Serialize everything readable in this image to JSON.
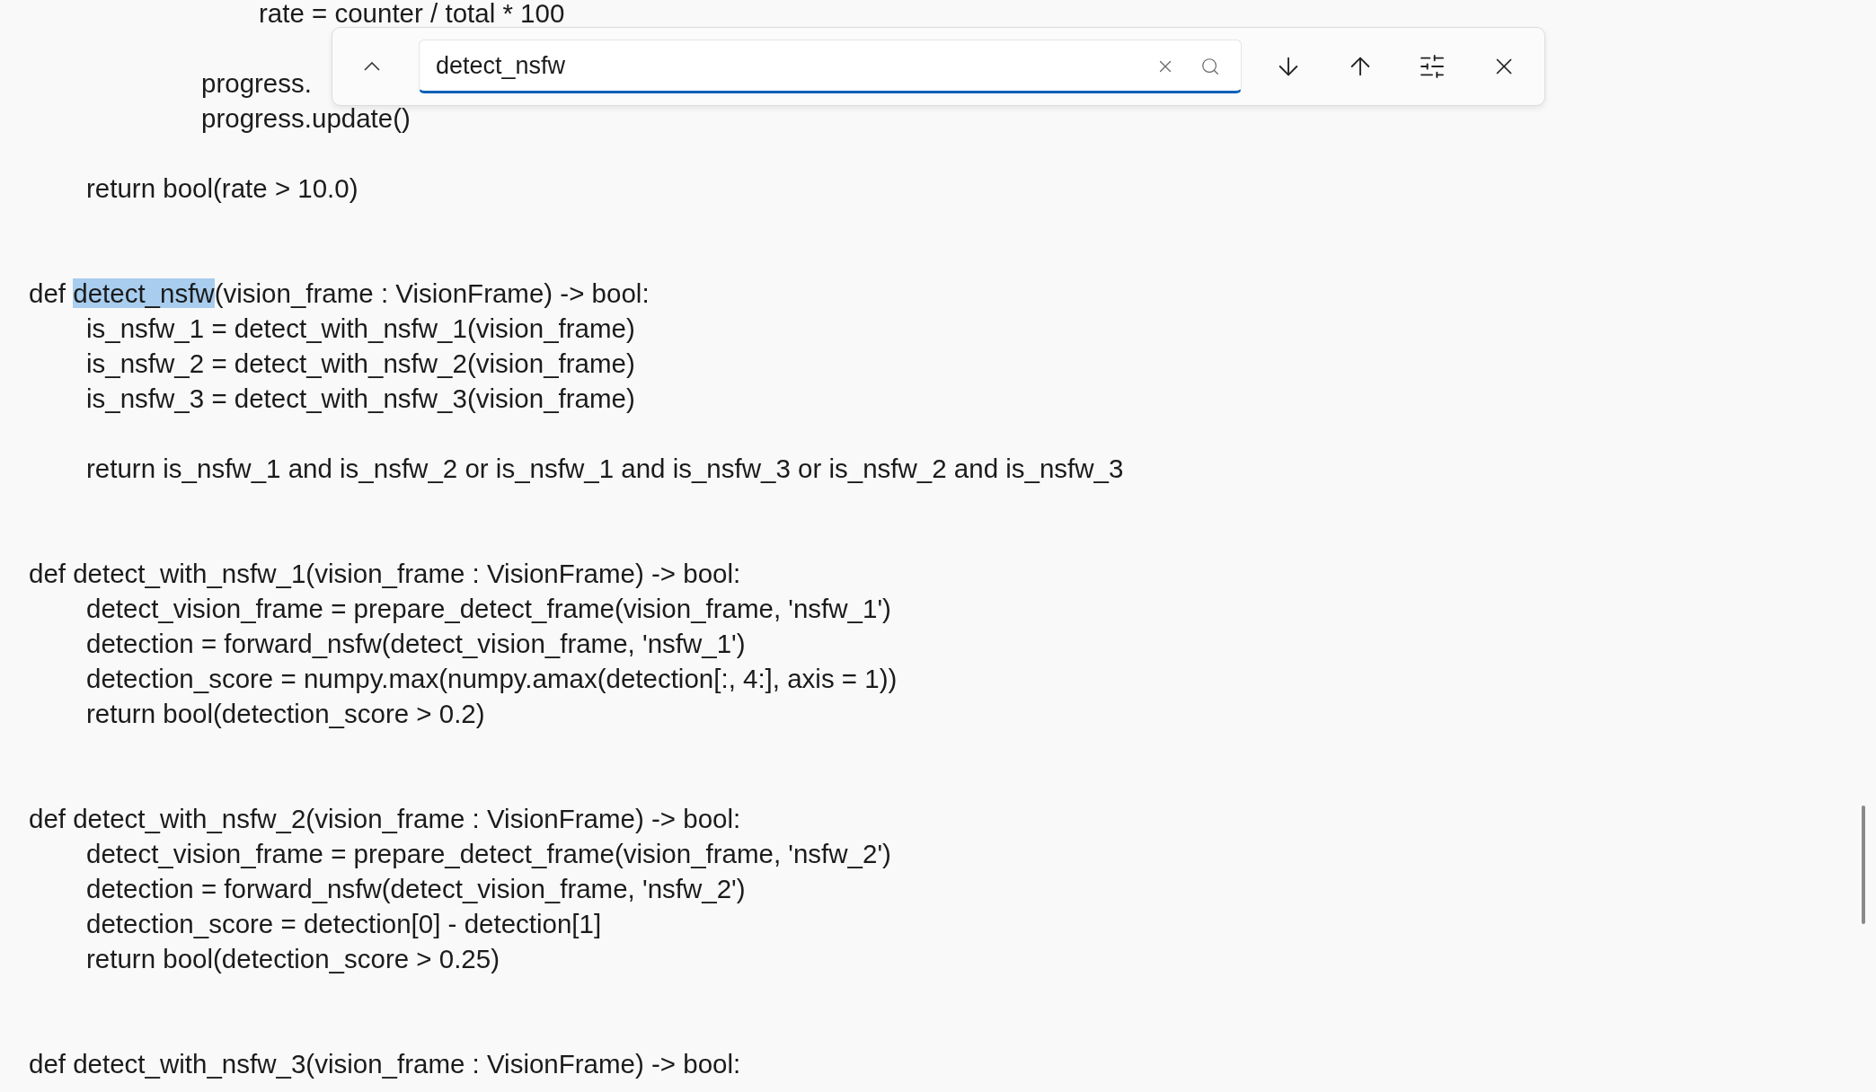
{
  "editor": {
    "lines": [
      {
        "text": "\t\t\t\trate = counter / total * 100"
      },
      {
        "kind": "blank"
      },
      {
        "text": "\t\t\tprogress."
      },
      {
        "text": "\t\t\tprogress.update()"
      },
      {
        "kind": "blank"
      },
      {
        "text": "\treturn bool(rate > 10.0)"
      },
      {
        "kind": "blank"
      },
      {
        "kind": "blank"
      },
      {
        "segments": [
          {
            "text": "def ",
            "selected": false
          },
          {
            "text": "detect_nsfw",
            "selected": true
          },
          {
            "text": "(vision_frame : VisionFrame) -> bool:",
            "selected": false
          }
        ]
      },
      {
        "text": "\tis_nsfw_1 = detect_with_nsfw_1(vision_frame)"
      },
      {
        "text": "\tis_nsfw_2 = detect_with_nsfw_2(vision_frame)"
      },
      {
        "text": "\tis_nsfw_3 = detect_with_nsfw_3(vision_frame)"
      },
      {
        "kind": "blank"
      },
      {
        "text": "\treturn is_nsfw_1 and is_nsfw_2 or is_nsfw_1 and is_nsfw_3 or is_nsfw_2 and is_nsfw_3"
      },
      {
        "kind": "blank"
      },
      {
        "kind": "blank"
      },
      {
        "text": "def detect_with_nsfw_1(vision_frame : VisionFrame) -> bool:"
      },
      {
        "text": "\tdetect_vision_frame = prepare_detect_frame(vision_frame, 'nsfw_1')"
      },
      {
        "text": "\tdetection = forward_nsfw(detect_vision_frame, 'nsfw_1')"
      },
      {
        "text": "\tdetection_score = numpy.max(numpy.amax(detection[:, 4:], axis = 1))"
      },
      {
        "text": "\treturn bool(detection_score > 0.2)"
      },
      {
        "kind": "blank"
      },
      {
        "kind": "blank"
      },
      {
        "text": "def detect_with_nsfw_2(vision_frame : VisionFrame) -> bool:"
      },
      {
        "text": "\tdetect_vision_frame = prepare_detect_frame(vision_frame, 'nsfw_2')"
      },
      {
        "text": "\tdetection = forward_nsfw(detect_vision_frame, 'nsfw_2')"
      },
      {
        "text": "\tdetection_score = detection[0] - detection[1]"
      },
      {
        "text": "\treturn bool(detection_score > 0.25)"
      },
      {
        "kind": "blank"
      },
      {
        "kind": "blank"
      },
      {
        "text": "def detect_with_nsfw_3(vision_frame : VisionFrame) -> bool:"
      }
    ]
  },
  "find_bar": {
    "expanded": false,
    "search_field": {
      "value": "detect_nsfw"
    }
  }
}
